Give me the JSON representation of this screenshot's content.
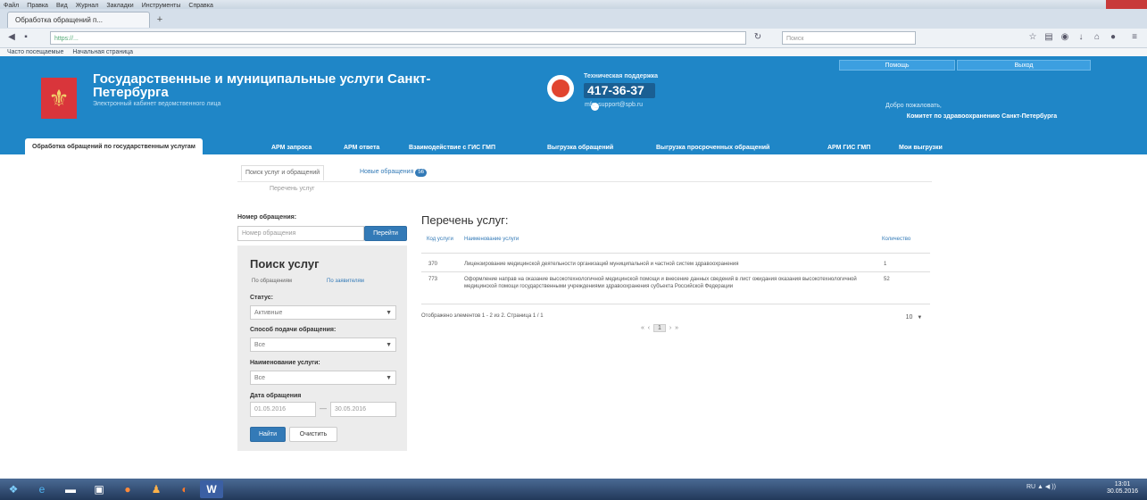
{
  "browser": {
    "menu": [
      "Файл",
      "Правка",
      "Вид",
      "Журнал",
      "Закладки",
      "Инструменты",
      "Справка"
    ],
    "tab_title": "Обработка обращений п...",
    "new_tab": "+",
    "url": "https://...",
    "search_placeholder": "Поиск",
    "bookmarks": [
      "Часто посещаемые",
      "Начальная страница"
    ]
  },
  "header": {
    "logo_glyph": "⚜",
    "title": "Государственные и муниципальные услуги Санкт-Петербурга",
    "subtitle": "Электронный кабинет ведомственного лица",
    "support_title": "Техническая поддержка",
    "phone": "417-36-37",
    "support_email": "mfc_support@spb.ru",
    "help_button": "Помощь",
    "logout_button": "Выход",
    "welcome": "Добро пожаловать,",
    "organization": "Комитет по здравоохранению Санкт-Петербурга"
  },
  "tabs": [
    "Обработка обращений по государственным услугам",
    "АРМ запроса",
    "АРМ ответа",
    "Взаимодействие с ГИС ГМП",
    "Выгрузка обращений",
    "Выгрузка просроченных обращений",
    "АРМ ГИС ГМП",
    "Мои выгрузки"
  ],
  "subtabs": {
    "list_label": "Поиск услуг и обращений",
    "new_label": "Новые обращения",
    "new_count": "56",
    "breadcrumb": "Перечень услуг"
  },
  "sidebar": {
    "app_number_label": "Номер обращения:",
    "app_number_placeholder": "Номер обращения",
    "find_button": "Перейти",
    "search_title": "Поиск услуг",
    "tab_by_apps": "По обращениям",
    "tab_by_services": "По заявителям",
    "status_label": "Статус:",
    "status_value": "Активные",
    "method_label": "Способ подачи обращения:",
    "method_value": "Все",
    "service_label": "Наименование услуги:",
    "service_value": "Все",
    "date_label": "Дата обращения",
    "date_from": "01.05.2016",
    "date_sep": "—",
    "date_to": "30.05.2016",
    "search_button": "Найти",
    "clear_button": "Очистить"
  },
  "services": {
    "title": "Перечень услуг:",
    "columns": [
      "Код услуги",
      "Наименование услуги",
      "Количество"
    ],
    "rows": [
      {
        "code": "370",
        "name": "Лицензирование медицинской деятельности организаций муниципальной и частной систем здравоохранения",
        "count": "1"
      },
      {
        "code": "773",
        "name": "Оформление направ на оказание высокотехнологичной медицинской помощи и внесение данных сведений в лист ожидания оказания высокотехнологичной медицинской помощи государственными учреждениями здравоохранения субъекта Российской Федерации",
        "count": "52"
      }
    ],
    "pager_info": "Отображено элементов 1 - 2 из 2. Страница 1 / 1",
    "page_size": "10",
    "pages": [
      "«",
      "‹",
      "1",
      "›",
      "»"
    ]
  },
  "taskbar": {
    "tray": "RU  ▲  ◀ ))",
    "time": "13:01",
    "date": "30.05.2016"
  }
}
